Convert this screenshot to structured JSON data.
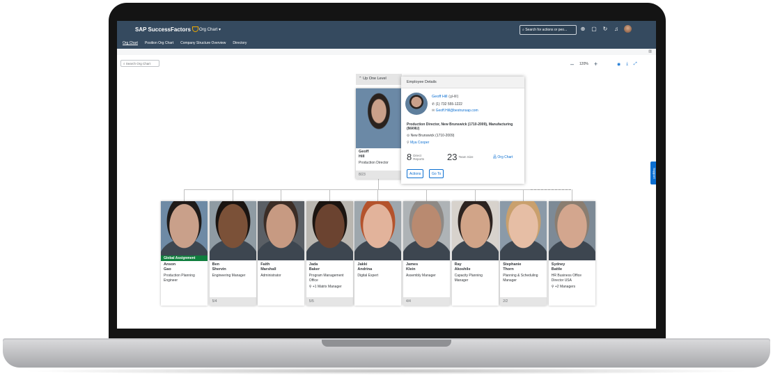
{
  "header": {
    "brand": "SAP SuccessFactors",
    "app_menu": "Org Chart ▾",
    "search_placeholder": "Search for actions or peo...",
    "icons": [
      "notification-icon",
      "chat-icon",
      "help-icon",
      "bell-icon",
      "avatar"
    ]
  },
  "subnav": {
    "items": [
      "Org Chart",
      "Position Org Chart",
      "Company Structure Overview",
      "Directory"
    ]
  },
  "toolbar": {
    "search_label": "Search Org Chart",
    "zoom": "120%"
  },
  "manager_card": {
    "up_label": "Up One Level",
    "first_name": "Geoff",
    "last_name": "Hill",
    "title": "Production Director",
    "footer": "8/23"
  },
  "details": {
    "heading": "Employee Details",
    "name": "Geoff Hill",
    "username": "(gHill)",
    "phone": "(1) 732 555-1222",
    "email": "Geoff.Hill@bestrunsap.com",
    "role": "Production Director, New Brunswick (1710-2009), Manufacturing (MANU)",
    "location": "New Brunswick (1710-2009)",
    "manager": "Mya Cooper",
    "direct_reports_num": "8",
    "direct_reports_label_1": "Direct",
    "direct_reports_label_2": "Reports",
    "team_size_num": "23",
    "team_size_label": "Team Size",
    "org_chart_link": "Org Chart",
    "actions_button": "Actions",
    "goto_button": "Go To"
  },
  "support_label": "Support",
  "employees": [
    {
      "first": "Anson",
      "last": "Gao",
      "title": "Production Planning Engineer",
      "badge": "Global Assignment",
      "extra": "",
      "footer": "",
      "skin": "#c9a08a",
      "hair": "#1e1a18",
      "bg": "#6e8aa5"
    },
    {
      "first": "Ben",
      "last": "Shervin",
      "title": "Engineering Manager",
      "badge": "",
      "extra": "",
      "footer": "5/4",
      "skin": "#7b5138",
      "hair": "#1a1411",
      "bg": "#8f9ba3"
    },
    {
      "first": "Faith",
      "last": "Marshall",
      "title": "Administrator",
      "badge": "",
      "extra": "",
      "footer": "",
      "skin": "#c79a82",
      "hair": "#3b2d26",
      "bg": "#5a5f65"
    },
    {
      "first": "Jada",
      "last": "Baker",
      "title": "Program Management Office",
      "badge": "",
      "extra": "+1 Matrix Manager",
      "footer": "5/5",
      "skin": "#6b4330",
      "hair": "#1b1410",
      "bg": "#b9b6b0"
    },
    {
      "first": "Jakki",
      "last": "Andrina",
      "title": "Digital Expert",
      "badge": "",
      "extra": "",
      "footer": "",
      "skin": "#e2b39b",
      "hair": "#b4532c",
      "bg": "#9ea7ad"
    },
    {
      "first": "James",
      "last": "Klein",
      "title": "Assembly Manager",
      "badge": "",
      "extra": "",
      "footer": "4/4",
      "skin": "#b98a70",
      "hair": "#8e8985",
      "bg": "#aeb3b6"
    },
    {
      "first": "Ray",
      "last": "Akoshile",
      "title": "Capacity Planning Manager",
      "badge": "",
      "extra": "",
      "footer": "",
      "skin": "#d1a488",
      "hair": "#2c2320",
      "bg": "#d7d2cc"
    },
    {
      "first": "Stephanie",
      "last": "Thorn",
      "title": "Planning & Scheduling Manager",
      "badge": "",
      "extra": "",
      "footer": "2/2",
      "skin": "#e6bea5",
      "hair": "#c9a06d",
      "bg": "#8b9aa8"
    },
    {
      "first": "Sydney",
      "last": "Battle",
      "title": "HR Business Office Director USA",
      "badge": "",
      "extra": "+2 Managers",
      "footer": "",
      "skin": "#d3a68e",
      "hair": "#8a7d70",
      "bg": "#7d8a96"
    }
  ]
}
